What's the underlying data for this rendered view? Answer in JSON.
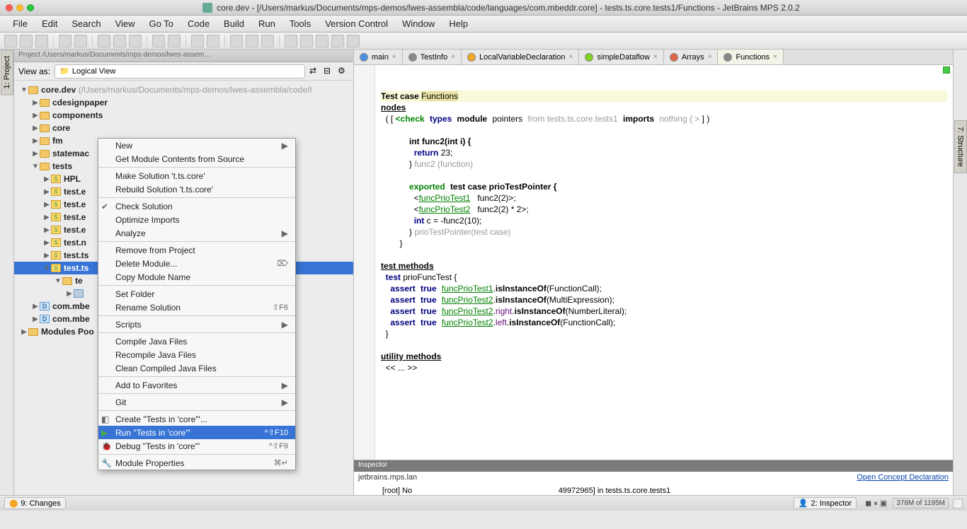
{
  "title": "core.dev - [/Users/markus/Documents/mps-demos/lwes-assembla/code/languages/com.mbeddr.core] - tests.ts.core.tests1/Functions - JetBrains MPS 2.0.2",
  "menu": [
    "File",
    "Edit",
    "Search",
    "View",
    "Go To",
    "Code",
    "Build",
    "Run",
    "Tools",
    "Version Control",
    "Window",
    "Help"
  ],
  "panel": {
    "header": "Project  /Users/markus/Documents/mps-demos/lwes-assem...",
    "view_as": "View as:",
    "view_mode": "Logical View"
  },
  "tree": [
    {
      "indent": 0,
      "arrow": "▼",
      "icon": "folder",
      "label": "core.dev",
      "path": " (/Users/markus/Documents/mps-demos/lwes-assembla/code/l"
    },
    {
      "indent": 1,
      "arrow": "▶",
      "icon": "folder",
      "label": "cdesignpaper"
    },
    {
      "indent": 1,
      "arrow": "▶",
      "icon": "folder",
      "label": "components"
    },
    {
      "indent": 1,
      "arrow": "▶",
      "icon": "folder",
      "label": "core"
    },
    {
      "indent": 1,
      "arrow": "▶",
      "icon": "folder",
      "label": "fm"
    },
    {
      "indent": 1,
      "arrow": "▶",
      "icon": "folder",
      "label": "statemac"
    },
    {
      "indent": 1,
      "arrow": "▼",
      "icon": "folder",
      "label": "tests"
    },
    {
      "indent": 2,
      "arrow": "▶",
      "icon": "s",
      "label": "HPL"
    },
    {
      "indent": 2,
      "arrow": "▶",
      "icon": "s",
      "label": "test.e"
    },
    {
      "indent": 2,
      "arrow": "▶",
      "icon": "s",
      "label": "test.e"
    },
    {
      "indent": 2,
      "arrow": "▶",
      "icon": "s",
      "label": "test.e"
    },
    {
      "indent": 2,
      "arrow": "▶",
      "icon": "s",
      "label": "test.e"
    },
    {
      "indent": 2,
      "arrow": "▶",
      "icon": "s",
      "label": "test.n"
    },
    {
      "indent": 2,
      "arrow": "▶",
      "icon": "s",
      "label": "test.ts"
    },
    {
      "indent": 2,
      "arrow": "▼",
      "icon": "s",
      "label": "test.ts",
      "selected": true
    },
    {
      "indent": 3,
      "arrow": "▼",
      "icon": "folder",
      "label": "te"
    },
    {
      "indent": 4,
      "arrow": "▶",
      "icon": "blue",
      "label": ""
    },
    {
      "indent": 1,
      "arrow": "▶",
      "icon": "d",
      "label": "com.mbe"
    },
    {
      "indent": 1,
      "arrow": "▶",
      "icon": "d",
      "label": "com.mbe"
    },
    {
      "indent": 0,
      "arrow": "▶",
      "icon": "folder",
      "label": "Modules Poo"
    }
  ],
  "context_menu": [
    {
      "label": "New",
      "sub": true
    },
    {
      "label": "Get Module Contents from Source"
    },
    {
      "sep": true
    },
    {
      "label": "Make Solution 't.ts.core'"
    },
    {
      "label": "Rebuild Solution 't.ts.core'"
    },
    {
      "sep": true
    },
    {
      "label": "Check Solution",
      "icon": "check"
    },
    {
      "label": "Optimize Imports"
    },
    {
      "label": "Analyze",
      "sub": true
    },
    {
      "sep": true
    },
    {
      "label": "Remove from Project"
    },
    {
      "label": "Delete Module...",
      "short": "⌦"
    },
    {
      "label": "Copy Module Name"
    },
    {
      "sep": true
    },
    {
      "label": "Set Folder"
    },
    {
      "label": "Rename Solution",
      "short": "⇧F6"
    },
    {
      "sep": true
    },
    {
      "label": "Scripts",
      "sub": true
    },
    {
      "sep": true
    },
    {
      "label": "Compile Java Files"
    },
    {
      "label": "Recompile Java Files"
    },
    {
      "label": "Clean Compiled Java Files"
    },
    {
      "sep": true
    },
    {
      "label": "Add to Favorites",
      "sub": true
    },
    {
      "sep": true
    },
    {
      "label": "Git",
      "sub": true
    },
    {
      "sep": true
    },
    {
      "label": "Create  \"Tests in 'core'\"...",
      "icon": "create"
    },
    {
      "label": "Run \"Tests in 'core'\"",
      "short": "^⇧F10",
      "selected": true,
      "icon": "run"
    },
    {
      "label": "Debug \"Tests in 'core'\"",
      "short": "^⇧F9",
      "icon": "debug"
    },
    {
      "sep": true
    },
    {
      "label": "Module Properties",
      "short": "⌘↵",
      "icon": "wrench"
    }
  ],
  "tabs": [
    {
      "label": "main",
      "color": "#4a90e2"
    },
    {
      "label": "TestInfo",
      "color": "#888"
    },
    {
      "label": "LocalVariableDeclaration",
      "color": "#f5a623"
    },
    {
      "label": "simpleDataflow",
      "color": "#7ed321"
    },
    {
      "label": "Arrays",
      "color": "#d64"
    },
    {
      "label": "Functions",
      "color": "#888",
      "active": true
    }
  ],
  "code": {
    "l1a": "Test case ",
    "l1b": "Functions",
    "l2": "nodes",
    "l3a": "  ( [ ",
    "l3_check": "<check",
    "l3_types": "types",
    "l3_module": "module",
    "l3_ptr": "pointers",
    "l3_from": "from tests.ts.core.tests1",
    "l3_imports": "imports",
    "l3_nothing": "nothing { >",
    "l3_end": " ] )",
    "l4": "            int func2(int i) {",
    "l5a": "              ",
    "l5_ret": "return",
    "l5b": " 23;",
    "l6a": "            } ",
    "l6_gray": "func2 (function)",
    "l7": "",
    "l8a": "            ",
    "l8_exp": "exported",
    "l8_test": "test case",
    "l8_name": " prioTestPointer {",
    "l9a": "              <",
    "l9_link": "funcPrioTest1",
    "l9b": "   func2(2)>;",
    "l10a": "              <",
    "l10_link": "funcPrioTest2",
    "l10b": "   func2(2) * 2>;",
    "l11a": "              ",
    "l11_int": "int",
    "l11b": " c = -func2(10);",
    "l12a": "            } ",
    "l12_gray": "prioTestPointer(test case)",
    "l13": "        }",
    "l14": "",
    "l15": "test methods",
    "l16a": "  ",
    "l16_test": "test",
    "l16b": " prioFuncTest {",
    "l17a": "    ",
    "l17_assert": "assert",
    "l17_true": "true",
    "l17_link": "funcPrioTest1",
    "l17b": ".",
    "l17_m": "isInstanceOf",
    "l17c": "(FunctionCall);",
    "l18a": "    ",
    "l18_assert": "assert",
    "l18_true": "true",
    "l18_link": "funcPrioTest2",
    "l18b": ".",
    "l18_m": "isInstanceOf",
    "l18c": "(MultiExpression);",
    "l19a": "    ",
    "l19_assert": "assert",
    "l19_true": "true",
    "l19_link": "funcPrioTest2",
    "l19b": ".",
    "l19_r": "right",
    "l19c": ".",
    "l19_m": "isInstanceOf",
    "l19d": "(NumberLiteral);",
    "l20a": "    ",
    "l20_assert": "assert",
    "l20_true": "true",
    "l20_link": "funcPrioTest2",
    "l20b": ".",
    "l20_l": "left",
    "l20c": ".",
    "l20_m": "isInstanceOf",
    "l20d": "(FunctionCall);",
    "l21": "  }",
    "l22": "",
    "l23": "utility methods",
    "l24": "  << ... >>"
  },
  "inspector": {
    "title": "Inspector",
    "breadcrumb": "jetbrains.mps.lan",
    "link": "Open Concept Declaration",
    "body_pre": "[root] No",
    "body_post": "49972965] in tests.ts.core.tests1"
  },
  "status": {
    "changes": "9: Changes",
    "inspector": "2: Inspector",
    "memory": "378M of 1195M"
  },
  "vert_labels": {
    "project": "1: Project",
    "structure": "7: Structure"
  }
}
